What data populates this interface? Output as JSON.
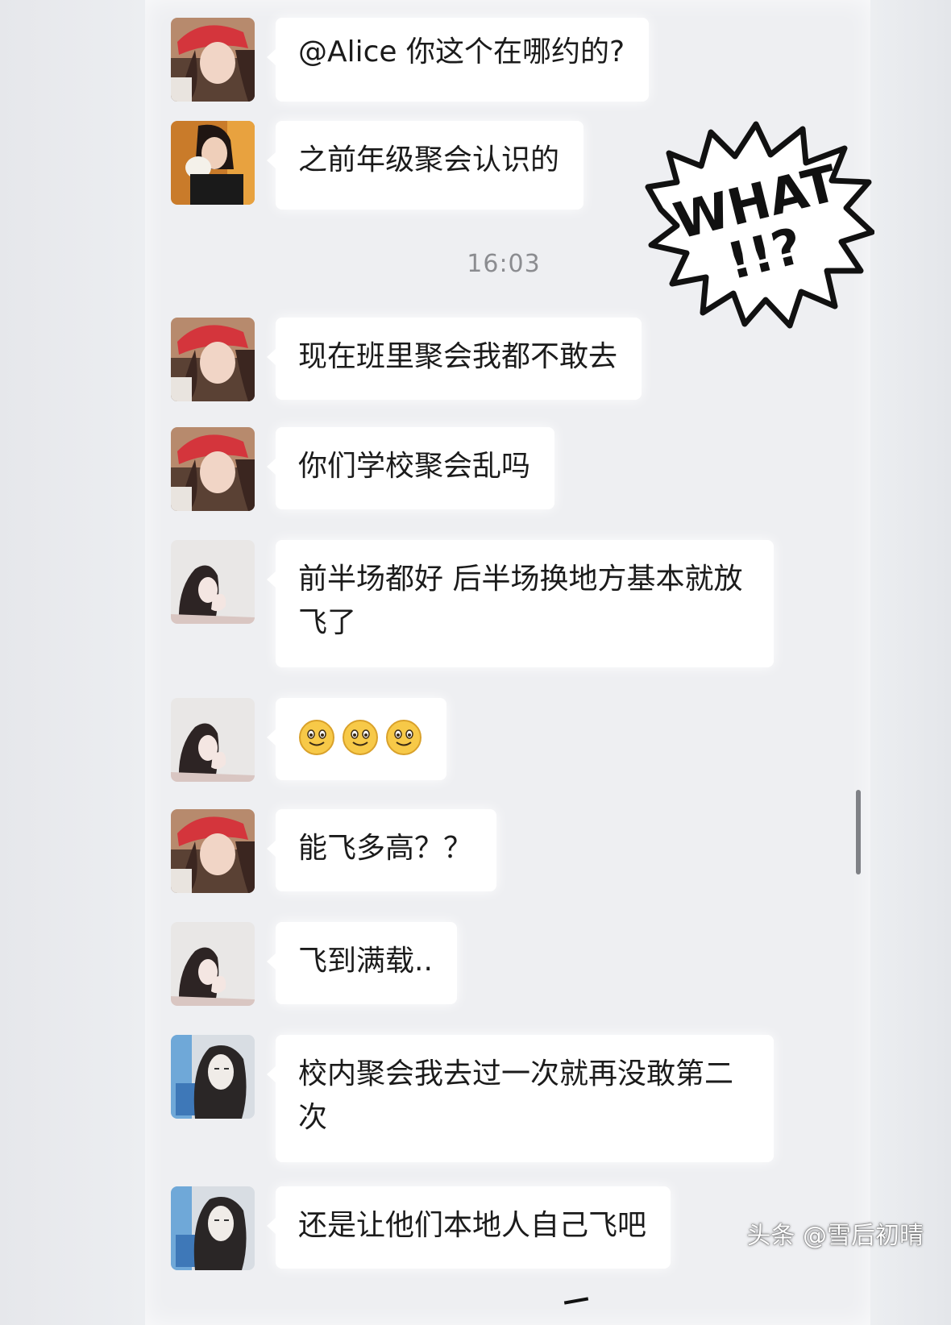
{
  "chat": {
    "time_divider": "16:03",
    "messages": [
      {
        "sender": "red-hat-girl",
        "text": "@Alice 你这个在哪约的?"
      },
      {
        "sender": "girl-with-pet",
        "text": "之前年级聚会认识的"
      },
      {
        "sender": "red-hat-girl",
        "text": "现在班里聚会我都不敢去"
      },
      {
        "sender": "red-hat-girl",
        "text": "你们学校聚会乱吗"
      },
      {
        "sender": "sketch-girl",
        "text": "前半场都好 后半场换地方基本就放飞了"
      },
      {
        "sender": "sketch-girl",
        "text": "",
        "emojis": [
          "smile",
          "smile",
          "smile"
        ]
      },
      {
        "sender": "red-hat-girl",
        "text": "能飞多高？？"
      },
      {
        "sender": "sketch-girl",
        "text": "飞到满载.."
      },
      {
        "sender": "drawn-girl",
        "text": "校内聚会我去过一次就再没敢第二次"
      },
      {
        "sender": "drawn-girl",
        "text": "还是让他们本地人自己飞吧"
      }
    ]
  },
  "sticker": {
    "text_line1": "WHAT",
    "text_line2": "!!?"
  },
  "watermark": "头条 @雪后初晴",
  "colors": {
    "bubble": "#ffffff",
    "background": "#eeeff2",
    "text": "#1b1b1b",
    "time": "#8b8c90"
  }
}
